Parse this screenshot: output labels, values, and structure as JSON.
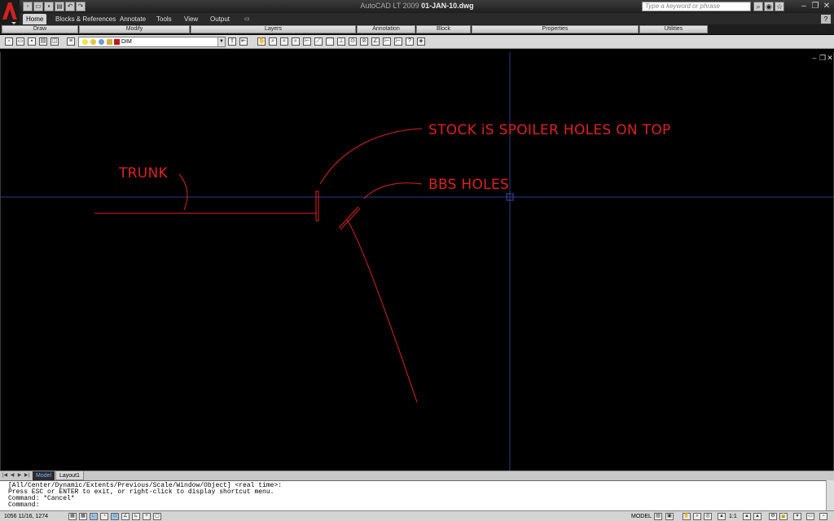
{
  "window": {
    "app_name": "AutoCAD LT 2009",
    "file_name": "01-JAN-10.dwg",
    "search_placeholder": "Type a keyword or phrase",
    "help_label": "?"
  },
  "ribbon": {
    "tabs": [
      {
        "label": "Home",
        "active": true
      },
      {
        "label": "Blocks & References",
        "active": false
      },
      {
        "label": "Annotate",
        "active": false
      },
      {
        "label": "Tools",
        "active": false
      },
      {
        "label": "View",
        "active": false
      },
      {
        "label": "Output",
        "active": false
      }
    ],
    "panels": [
      {
        "label": "Draw"
      },
      {
        "label": "Modify"
      },
      {
        "label": "Layers"
      },
      {
        "label": "Annotation"
      },
      {
        "label": "Block"
      },
      {
        "label": "Properties"
      },
      {
        "label": "Utilities"
      }
    ]
  },
  "toolbar": {
    "layer_name": "DIM"
  },
  "drawing": {
    "annotations": {
      "stock": "STOCK iS SPOILER HOLES ON TOP",
      "trunk": "TRUNK",
      "bbs": "BBS HOLES"
    },
    "line_color": "#e02020",
    "crosshair_color": "#2a3a8c"
  },
  "layout_tabs": {
    "model": "Model",
    "layout1": "Layout1"
  },
  "command": {
    "lines": [
      "[All/Center/Dynamic/Extents/Previous/Scale/Window/Object] <real time>:",
      "Press ESC or ENTER to exit, or right-click to display shortcut menu.",
      "Command: *Cancel*",
      "Command:"
    ]
  },
  "status": {
    "coordinates": "1056 11/16, 1274",
    "model_label": "MODEL",
    "annotation_scale": "1:1"
  }
}
